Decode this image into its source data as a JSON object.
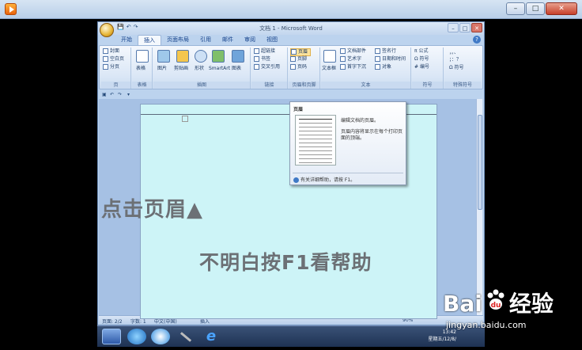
{
  "outer_window": {
    "buttons": {
      "minimize": "–",
      "maximize": "□",
      "close": "✕"
    }
  },
  "word": {
    "title": "文档 1 - Microsoft Word",
    "qat": [
      "💾",
      "↶",
      "↷"
    ],
    "tabs": [
      "开始",
      "插入",
      "页面布局",
      "引用",
      "邮件",
      "审阅",
      "视图"
    ],
    "active_tab": 1,
    "ribbon": {
      "page_group": {
        "items": [
          "封面",
          "空白页",
          "分页"
        ],
        "label": "页"
      },
      "table_group": {
        "items": [
          "表格"
        ],
        "label": "表格"
      },
      "illustration_group": {
        "items": [
          "图片",
          "剪贴画",
          "形状",
          "SmartArt",
          "图表"
        ],
        "label": "插图"
      },
      "links_group": {
        "items": [
          "超链接",
          "书签",
          "交叉引用"
        ],
        "label": "链接"
      },
      "header_footer_group": {
        "items": [
          "页眉",
          "页脚",
          "页码"
        ],
        "label": "页眉和页脚"
      },
      "text_group": {
        "items": [
          "文本框",
          "文档部件",
          "艺术字",
          "首字下沉",
          "签名行",
          "日期和时间",
          "对象"
        ],
        "label": "文本"
      },
      "symbols_group": {
        "items": [
          "公式",
          "符号",
          "编号"
        ],
        "label": "符号"
      },
      "special_group": {
        "items": [
          "符号"
        ],
        "label": "特殊符号"
      }
    },
    "status": {
      "page": "页面: 2/2",
      "words": "字数: 1",
      "language": "中文(中国)",
      "insert": "插入",
      "zoom": "90%"
    },
    "document_text": {
      "line1": "点击页眉▲",
      "line2": "不明白按F1看帮助"
    },
    "tooltip": {
      "title": "页眉",
      "desc1": "编辑文档的页眉。",
      "desc2": "页眉内容将显示在每个打印页面的顶端。",
      "help": "有关详细帮助，请按 F1。"
    }
  },
  "taskbar": {
    "clock_time": "13:42",
    "clock_date": "星期五/12/8/"
  },
  "watermark": {
    "brand_left": "Bai",
    "brand_right": "经验",
    "url": "jingyan.baidu.com"
  }
}
